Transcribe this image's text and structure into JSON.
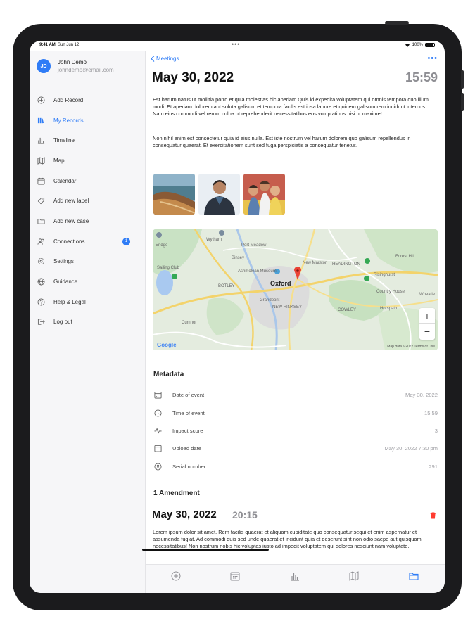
{
  "status": {
    "time": "9:41 AM",
    "date": "Sun Jun 12",
    "battery": "100%"
  },
  "user": {
    "initials": "JD",
    "name": "John Demo",
    "email": "johndemo@email.com"
  },
  "sidebar": {
    "items": [
      {
        "label": "Add Record",
        "icon": "plus-circle-icon",
        "active": false
      },
      {
        "label": "My Records",
        "icon": "records-icon",
        "active": true
      },
      {
        "label": "Timeline",
        "icon": "timeline-icon",
        "active": false
      },
      {
        "label": "Map",
        "icon": "map-icon",
        "active": false
      },
      {
        "label": "Calendar",
        "icon": "calendar-icon",
        "active": false
      },
      {
        "label": "Add new label",
        "icon": "tag-icon",
        "active": false
      },
      {
        "label": "Add new case",
        "icon": "folder-icon",
        "active": false
      },
      {
        "label": "Connections",
        "icon": "people-icon",
        "active": false,
        "badge": "1"
      },
      {
        "label": "Settings",
        "icon": "gear-icon",
        "active": false
      },
      {
        "label": "Guidance",
        "icon": "globe-icon",
        "active": false
      },
      {
        "label": "Help & Legal",
        "icon": "help-icon",
        "active": false
      },
      {
        "label": "Log out",
        "icon": "logout-icon",
        "active": false
      }
    ]
  },
  "header": {
    "back_label": "Meetings",
    "more_label": "•••",
    "title": "May 30, 2022",
    "time": "15:59"
  },
  "body": {
    "p1": "Est harum natus ut mollitia porro et quia molestias hic aperiam Quis id expedita voluptatem qui omnis tempora quo illum modi. Et aperiam dolorem aut soluta galisum et tempora facilis est ipsa labore et quidem galisum rem incidunt internos. Nam eius commodi vel rerum culpa ut reprehenderit necessitatibus eos voluptatibus nisi ut maxime!",
    "p2": "Non nihil enim est consectetur quia id eius nulla. Est iste nostrum vel harum dolorem quo galisum repellendus in consequatur quaerat. Et exercitationem sunt sed fuga perspiciatis a consequatur tenetur."
  },
  "map": {
    "labels": {
      "wytham": "Wytham",
      "port_meadow": "Port Meadow",
      "binsey": "Binsey",
      "ashmolean": "Ashmolean Museum",
      "oxford": "Oxford",
      "new_marston": "New Marston",
      "headington": "HEADINGTON",
      "botley": "BOTLEY",
      "grandpont": "Grandpont",
      "new_hinksey": "NEW HINKSEY",
      "cumnor": "Cumnor",
      "risinghurst": "Risinghurst",
      "wheatley": "Wheatle",
      "forest_hill": "Forest Hill",
      "horspath": "Horspath",
      "cowley": "COWLEY",
      "sailing_club": "Sailing Club",
      "lower_end": "Endge",
      "country_house": "Country House"
    },
    "google": "Google",
    "legal": "Map data ©2022   Terms of Use",
    "zoom_in": "+",
    "zoom_out": "−"
  },
  "metadata": {
    "title": "Metadata",
    "rows": [
      {
        "key": "Date of event",
        "value": "May 30, 2022",
        "icon": "calendar-icon"
      },
      {
        "key": "Time of event",
        "value": "15:59",
        "icon": "clock-icon"
      },
      {
        "key": "Impact score",
        "value": "3",
        "icon": "pulse-icon"
      },
      {
        "key": "Upload date",
        "value": "May 30, 2022 7:30 pm",
        "icon": "upload-calendar-icon"
      },
      {
        "key": "Serial number",
        "value": "291",
        "icon": "serial-icon"
      }
    ]
  },
  "amendments": {
    "title": "1 Amendment",
    "date": "May 30, 2022",
    "time": "20:15",
    "text": "Lorem ipsum dolor sit amet. Rem facilis quaerat et aliquam cupiditate quo consequatur sequi et enim aspernatur et assumenda fugiat. Ad commodi quis sed unde quaerat et incidunt quia et deserunt sint non odio saepe aut quisquam necessitatibus! Non nostrum nobis hic voluptas iusto ad impedit voluptatem qui dolores nesciunt nam voluptate."
  },
  "colors": {
    "accent": "#2f7cf6",
    "delete": "#ff3b30",
    "pin": "#ea4335"
  }
}
